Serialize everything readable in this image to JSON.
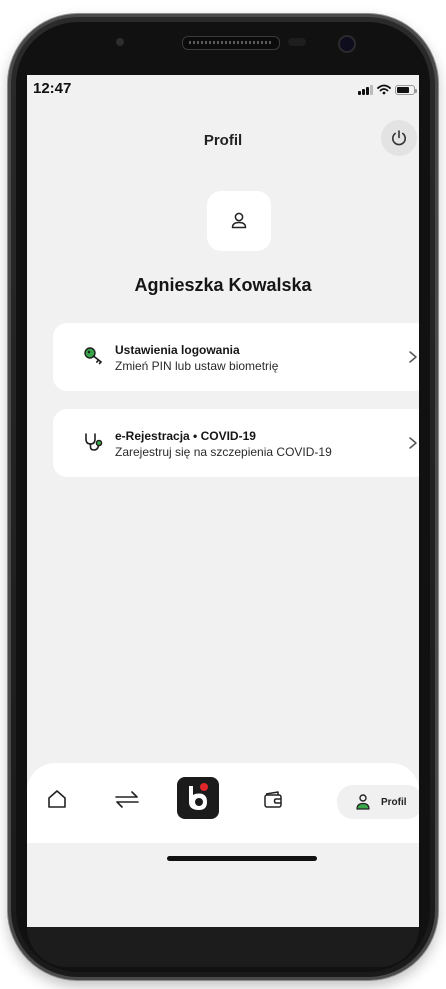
{
  "status_bar": {
    "time": "12:47",
    "battery_level": 0.75,
    "signal_icon": "cellular-signal-icon",
    "wifi_icon": "wifi-icon",
    "battery_icon": "battery-icon"
  },
  "header": {
    "title": "Profil",
    "power_icon": "power-icon"
  },
  "profile": {
    "avatar_icon": "user-icon",
    "name": "Agnieszka Kowalska"
  },
  "menu": {
    "items": [
      {
        "icon": "key-icon",
        "title": "Ustawienia logowania",
        "subtitle": "Zmień PIN lub ustaw biometrię",
        "chevron_icon": "chevron-right-icon"
      },
      {
        "icon": "stethoscope-icon",
        "title": "e-Rejestracja • COVID-19",
        "subtitle": "Zarejestruj się na szczepienia COVID-19",
        "chevron_icon": "chevron-right-icon"
      }
    ]
  },
  "bottom_nav": {
    "items": [
      {
        "icon": "home-icon"
      },
      {
        "icon": "transfer-arrows-icon"
      },
      {
        "icon": "blik-icon"
      },
      {
        "icon": "wallet-icon"
      },
      {
        "icon": "profile-icon",
        "label": "Profil",
        "active": true
      }
    ]
  },
  "colors": {
    "screen_bg": "#f1f1f1",
    "card_bg": "#ffffff",
    "accent_green": "#3aa84a",
    "blik_red": "#e0262b"
  }
}
